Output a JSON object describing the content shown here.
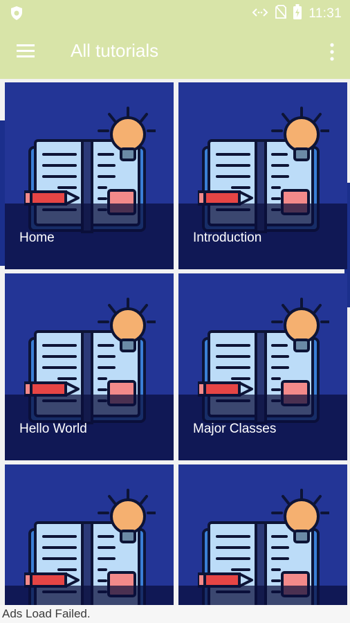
{
  "status_bar": {
    "time": "11:31"
  },
  "app_bar": {
    "title": "All tutorials"
  },
  "tutorials": [
    {
      "label": "Home"
    },
    {
      "label": "Introduction"
    },
    {
      "label": "Hello World"
    },
    {
      "label": "Major Classes"
    },
    {
      "label": ""
    },
    {
      "label": ""
    }
  ],
  "ads_message": "Ads Load Failed.",
  "colors": {
    "app_bar": "#d8e4a8",
    "card_background": "#233596",
    "overlay": "#0a0e3c",
    "book_page": "#bcdcf8",
    "book_cover": "#3a7fd6",
    "bulb": "#f5b070",
    "pencil": "#e64545",
    "sticky": "#f38a8a"
  }
}
